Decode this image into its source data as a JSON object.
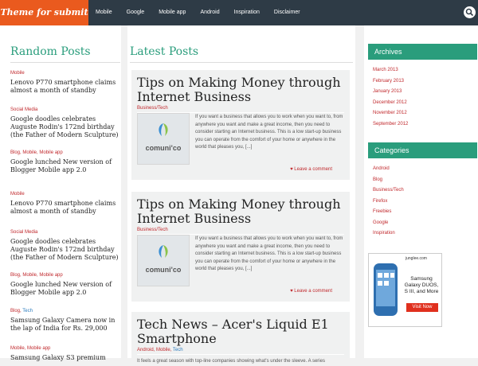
{
  "header": {
    "logo": "Theme for submit",
    "nav": [
      "Mobile",
      "Google",
      "Mobile app",
      "Android",
      "Inspiration",
      "Disclaimer"
    ]
  },
  "random_posts": {
    "title": "Random Posts",
    "items": [
      {
        "cats": "Mobile",
        "tech": "",
        "title": "Lenovo P770 smartphone claims almost a month of standby"
      },
      {
        "cats": "Social Media",
        "tech": "",
        "title": "Google doodles celebrates Auguste Rodin's 172nd birthday (the Father of Modern Sculpture)"
      },
      {
        "cats": "Blog, Mobile, Mobile app",
        "tech": "",
        "title": "Google lunched New version of Blogger Mobile app 2.0"
      },
      {
        "cats": "Mobile",
        "tech": "",
        "title": "Lenovo P770 smartphone claims almost a month of standby"
      },
      {
        "cats": "Social Media",
        "tech": "",
        "title": "Google doodles celebrates Auguste Rodin's 172nd birthday (the Father of Modern Sculpture)"
      },
      {
        "cats": "Blog, Mobile, Mobile app",
        "tech": "",
        "title": "Google lunched New version of Blogger Mobile app 2.0"
      },
      {
        "cats": "Blog, ",
        "tech": "Tech",
        "title": "Samsung Galaxy Camera now in the lap of India for Rs. 29,000"
      },
      {
        "cats": "Mobile, Mobile app",
        "tech": "",
        "title": "Samsung Galaxy S3 premium"
      }
    ]
  },
  "latest_posts": {
    "title": "Latest Posts",
    "posts": [
      {
        "title": "Tips on Making Money through Internet Business",
        "cats": "Business/Tech",
        "tech": "",
        "thumb": "comuni'co",
        "excerpt": "If you want a business that allows you to work when you want to, from anywhere you want and make a great income, then you need to consider starting an Internet business. This is a low start-up business you can operate from the comfort of your home or anywhere in the world that pleases you, [...]",
        "comment": "Leave a comment"
      },
      {
        "title": "Tips on Making Money through Internet Business",
        "cats": "Business/Tech",
        "tech": "",
        "thumb": "comuni'co",
        "excerpt": "If you want a business that allows you to work when you want to, from anywhere you want and make a great income, then you need to consider starting an Internet business. This is a low start-up business you can operate from the comfort of your home or anywhere in the world that pleases you, [...]",
        "comment": "Leave a comment"
      },
      {
        "title": "Tech News – Acer's Liquid E1 Smartphone",
        "cats": "Android, Mobile, ",
        "tech": "Tech",
        "excerpt": "It feels a great season with top-line companies showing what's under the sleeve. A series"
      }
    ]
  },
  "sidebar": {
    "archives_title": "Archives",
    "archives": [
      "March 2013",
      "February 2013",
      "January 2013",
      "December 2012",
      "November 2012",
      "September 2012"
    ],
    "categories_title": "Categories",
    "categories": [
      "Android",
      "Blog",
      "Business/Tech",
      "Firefox",
      "Freebies",
      "Google",
      "Inspiration"
    ],
    "ad": {
      "brand": "junglee.com",
      "text": "Samsung Galaxy DUOS, S III, and More",
      "cta": "Visit Now"
    }
  },
  "colors": {
    "accent": "#2a9d7c",
    "brand": "#ea5a1e",
    "category": "#c0282c",
    "topbar": "#2e3b46"
  }
}
